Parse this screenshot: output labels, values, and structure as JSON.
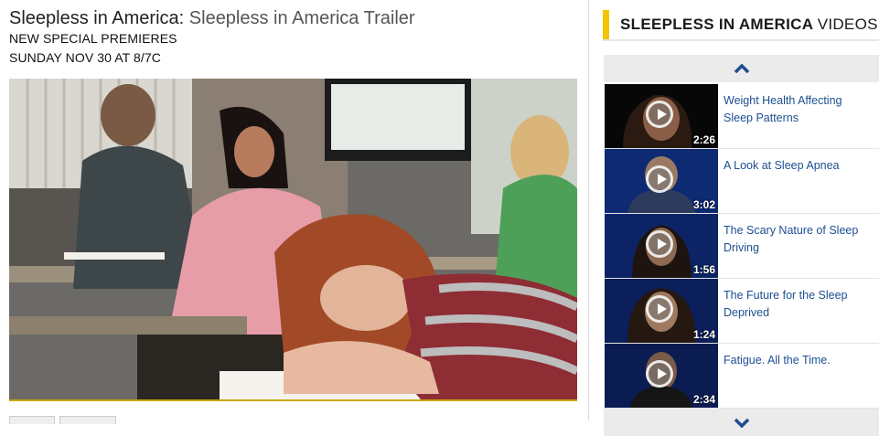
{
  "header": {
    "show": "Sleepless in America",
    "separator": ":",
    "video_title": "Sleepless in America Trailer",
    "line1": "NEW SPECIAL PREMIERES",
    "line2": "SUNDAY NOV 30 at 8/7c"
  },
  "sidebar": {
    "heading_bold": "SLEEPLESS IN AMERICA",
    "heading_light": "VIDEOS",
    "up_icon": "chevron-up-icon",
    "down_icon": "chevron-down-icon",
    "items": [
      {
        "title": "Weight Health Affecting Sleep Patterns",
        "duration": "2:26"
      },
      {
        "title": "A Look at Sleep Apnea",
        "duration": "3:02"
      },
      {
        "title": "The Scary Nature of Sleep Driving",
        "duration": "1:56"
      },
      {
        "title": "The Future for the Sleep Deprived",
        "duration": "1:24"
      },
      {
        "title": "Fatigue. All the Time.",
        "duration": "2:34"
      }
    ]
  },
  "colors": {
    "accent": "#f2c500",
    "link": "#1d4f91",
    "thumb_bg": "#0b1a44"
  }
}
